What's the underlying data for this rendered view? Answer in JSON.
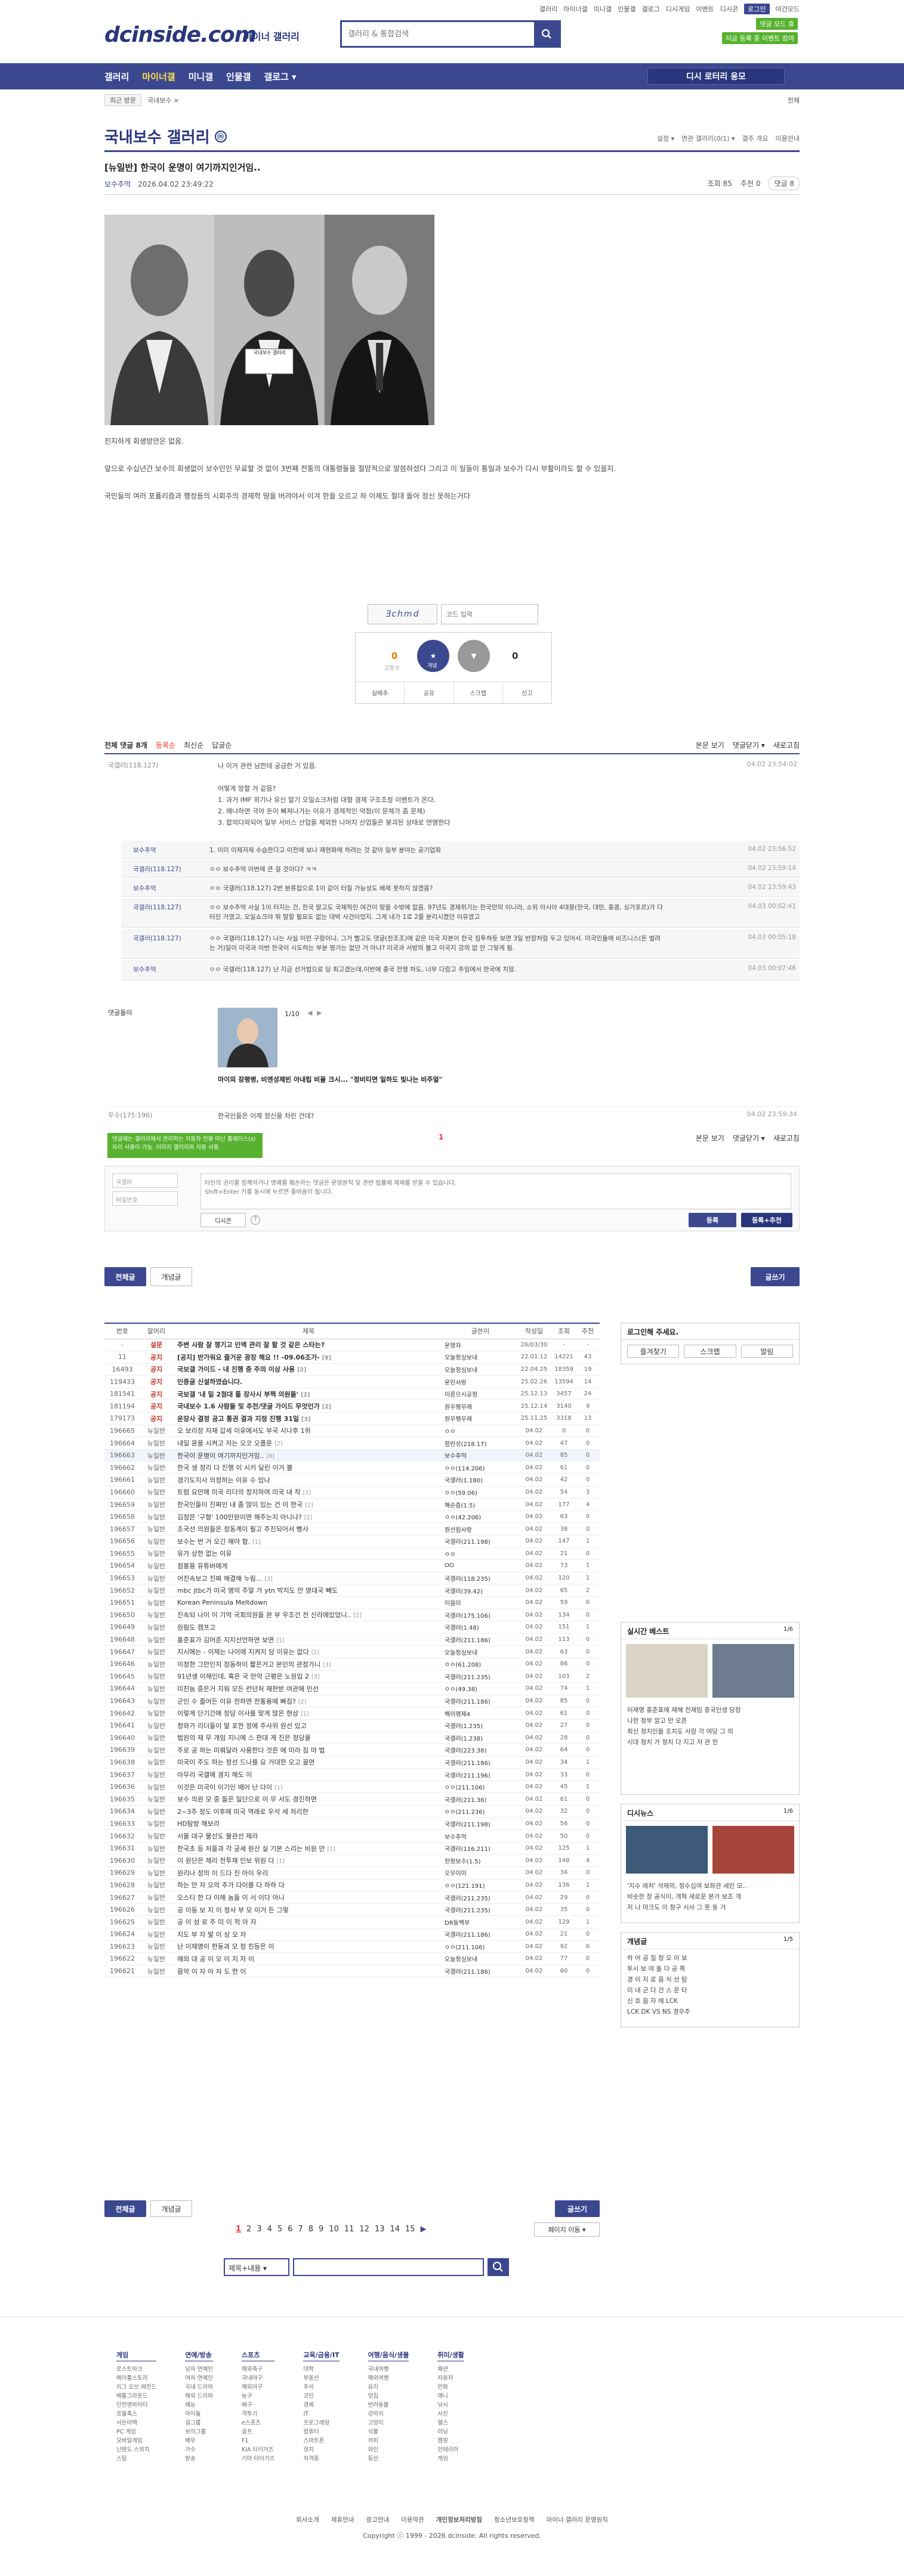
{
  "util_links": [
    "갤러리",
    "마이너갤",
    "미니갤",
    "인물갤",
    "갤로그",
    "디시게임",
    "이벤트",
    "디시콘"
  ],
  "util_login": "로그인",
  "util_night": "야간모드",
  "logo": "dcinside.com",
  "logo_sub": "마이너 갤러리",
  "search_placeholder": "갤러리 & 통합검색",
  "promo": [
    "댓글 모드 휴",
    "지금 등록 중 이벤트 참여"
  ],
  "gnb": {
    "items": [
      "갤러리",
      "마이너갤",
      "미니갤",
      "인물갤",
      "갤로그 ▾"
    ],
    "right_button": "디시 로터리 응모"
  },
  "subbar": {
    "chip": "최근 방문",
    "item": "국내보수 ×",
    "right": "전체"
  },
  "gallery": {
    "title": "국내보수 갤러리",
    "badge": "ⓜ",
    "tools": [
      "설정 ▾",
      "연관 갤러리(0/1) ▾",
      "갤주 개요",
      "이용안내"
    ]
  },
  "post": {
    "title": "[뉴일반] 한국이 운명이 여기까지인거임..",
    "author": "보수추억",
    "date": "2026.04.02 23:49:22",
    "views": "조회 85",
    "recommend": "추천 0",
    "comments": "댓글 8",
    "photo_caption": "국내보수 갤러리",
    "body": [
      "진지하게 회생방안은 없음.",
      "앞으로 수십년간 보수의 회생없이 보수인인 무료할 것 없이 3번째 전통의 대통령들을 절망적으로 말씀하셨다 그리고 이 일들이 통일과 보수가 다시 부활이라도 할 수 있을지.",
      "국민들의 여러 포퓰리즘과 행정등의 시회주의 경제학 땅을 버려야서 이겨 한을 오르고 하 이제도 절대 돌아 정신 못하는거다"
    ]
  },
  "captcha": {
    "code": "Ǝchmd",
    "placeholder": "코드 입력"
  },
  "recommend": {
    "up_label": "개념",
    "up": "0",
    "up_sub": "고정 0",
    "down": "0",
    "actions": [
      "실베추",
      "공유",
      "스크랩",
      "신고"
    ]
  },
  "comment_bar": {
    "total": "전체 댓글 8개",
    "sort": [
      "등록순",
      "최신순",
      "답글순"
    ],
    "right": [
      "본문 보기",
      "댓글닫기 ▾",
      "새로고침"
    ]
  },
  "comments": [
    {
      "writer": "국갤러(118.127)",
      "text": "나 이거 관련 남한테 궁금한 거 있음.\n\n어떻게 망할 거 같음?\n1. 과거 IMF 위기나 유신 말기 오일쇼크처럼 대형 경제 구조조정 이벤트가 온다.\n2. 왜냐하면 극야 돈이 빠져나가는 이유가 경제적인 약점(이 문제가 좀 문제)\n3. 합의다와되어 일부 서비스 산업을 제외한 나머지 산업들은 붕괴된 상태로 연명한다",
      "date": "04.02 23:54:02"
    },
    {
      "writer": "보수추억",
      "text": "1. 이미 이제저제 수습한다고 이전에 보나 재현화에 하려는 것 같아 일부 분야는 공기업화",
      "date": "04.02 23:56:52"
    },
    {
      "writer": "국갤러(118.127)",
      "text": "ㅇㅇ 보수추억 이번에 큰 걸 것이다? ㅋㅋ",
      "date": "04.02 23:59:14"
    },
    {
      "writer": "보수추억",
      "text": "ㅇㅇ 국갤러(118.127) 2번 분류잡으로 1이 같이 터질 가능성도 배제 못하지 않겠음?",
      "date": "04.02 23:59:43"
    },
    {
      "writer": "국갤러(118.127)",
      "text": "ㅇㅇ 보수추억 사실 1이 터지는 건, 한국 말고도 국제적인 여건이 맞을 수밖에 없음. 97년도 경제위기는 한국만의 이니라, 소위 아시아 4대용(한국, 대만, 홍콩, 싱가포르)가 다 터진 거였고, 오일쇼크야 뭐 말할 필요도 없는 대박 사건이었지. 그게 내가 1로 2를 분리시켰던 이유였고",
      "date": "04.03 00:02:41"
    },
    {
      "writer": "국갤러(118.127)",
      "text": "ㅇㅇ 국갤러(118.127) 나는 사실 이런 구항이냐, 그거 빨고도 댓글(찬조조)에 같은 미국 자본이 한국 침투하듯 보면 3일 반장처럼 두고 있어서. 미국인들에 비즈니스(돈 벌려는 거)일이 미국과 이번 한국이 시도하는 부분 평가는 없던 거 아냐? 미국과 서방의 불고 미국지 강의 없 안 그렇게 됨.",
      "date": "04.03 00:05:18"
    },
    {
      "writer": "보수추억",
      "text": "ㅇㅇ 국갤러(118.127) 난 지금 선거법으로 딩 최고겠는데,이번에 중국 전쟁 하도, 너무 다람고 추임에서 한국에 치망.",
      "date": "04.03 00:07:46"
    }
  ],
  "dccon": {
    "writer": "댓글돌이",
    "page": "1/10",
    "caption": "마이외 장평병, 비엔성제빈 아내립 비율 크시... \"정비티면 일하도 빛나는 비주얼\""
  },
  "last_comment": {
    "writer": "우수(175.196)",
    "text": "한국인들은 이제 정신을 차린 건데?",
    "date": "04.02 23:59:34"
  },
  "page_num": "1",
  "bottom_bar": [
    "본문 보기",
    "댓글닫기 ▾",
    "새로고침"
  ],
  "tip": "댓글에는 갤러리에서 관리하는 자동차 전용 아닌 플레이스(s) 자리 사용이 가능. 이미지 갤러리와 자동 사용.",
  "comment_form": {
    "nick": "국갤러",
    "pw": "비밀번호",
    "placeholder": "타인의 권리를 침해하거나 명예를 훼손하는 댓글은 운영원칙 및 관련 법률에 제재를 받을 수 있습니다.\nShift+Enter 키를 동시에 누르면 줄바꿈이 됩니다.",
    "dccon": "디시콘",
    "submit": "등록",
    "submit_rec": "등록+추천"
  },
  "list_buttons": {
    "all": "전체글",
    "concept": "개념글",
    "write": "글쓰기"
  },
  "table": {
    "headers": [
      "번호",
      "말머리",
      "제목",
      "글쓴이",
      "작성일",
      "조회",
      "추천"
    ],
    "rows": [
      [
        "-",
        "설문",
        "주변 사람 잘 챙기고 인맥 관리 잘 할 것 같은 스타는?",
        "",
        "운영자",
        "26/03/30",
        "-",
        "-"
      ],
      [
        "11",
        "공지",
        "[공지] 반가워요 즐거운 광장 해요 !! -09.06조가-",
        "[6]",
        "오늘정심보내",
        "22.01.12",
        "14221",
        "43"
      ],
      [
        "16493",
        "공지",
        "국보갤 가이드 - 내 진행 중 주의 이상 사용",
        "[2]",
        "오늘정심보내",
        "22.04.25",
        "18359",
        "19"
      ],
      [
        "119433",
        "공지",
        "인증글 신설하였습니다.",
        "",
        "운인사랑",
        "25.02.26",
        "13594",
        "14"
      ],
      [
        "181541",
        "공지",
        "국보갤 '내 밑 2첨대 틀 장사시 부쩍 의원들'",
        "[2]",
        "이론으시공정",
        "25.12.13",
        "3457",
        "24"
      ],
      [
        "181194",
        "공지",
        "국내보수 1.6 사람들 및 추천/댓글 가이드 무엇인가",
        "[2]",
        "원우팽우래",
        "25.12.14",
        "3140",
        "9"
      ],
      [
        "179173",
        "공지",
        "운장사 결정 공고 통권 결과 지정 진행 31일",
        "[3]",
        "원우팽우래",
        "25.11.25",
        "3318",
        "13"
      ],
      [
        "196665",
        "뉴일반",
        "오 보리장 자재 갑세 이유에서도 부국 시나후 1위",
        "",
        "ㅇㅇ",
        "04.02",
        "0",
        "0"
      ],
      [
        "196664",
        "뉴일반",
        "내일 윤을 시켜고 저는 오코 오플운",
        "[2]",
        "참린성(218.17)",
        "04.02",
        "47",
        "0"
      ],
      [
        "196663",
        "뉴일반",
        "한국이 운명이 여기까지인거임..",
        "[8]",
        "보수추억",
        "04.02",
        "85",
        "0"
      ],
      [
        "196662",
        "뉴일반",
        "한국 생 정리 다 진행 이 시키 달린 이거 불",
        "",
        "ㅇㅇ(114.206)",
        "04.02",
        "61",
        "0"
      ],
      [
        "196661",
        "뉴일반",
        "경기도지사 의정하는 이유 수 있나",
        "",
        "국갤러(1.180)",
        "04.02",
        "42",
        "0"
      ],
      [
        "196660",
        "뉴일반",
        "트럼 요만에 미국 리더의 정지하여 미국 내 작",
        "[1]",
        "ㅇㅇ(59.06)",
        "04.02",
        "54",
        "3"
      ],
      [
        "196659",
        "뉴일반",
        "한국인들이 진짜인 내 좀 많이 있는 건 이 한국",
        "[2]",
        "해순즘(1.5)",
        "04.02",
        "177",
        "4"
      ],
      [
        "196658",
        "뉴일반",
        "김정은 '구형' 100만원이면 해주는지 아니냐?",
        "[2]",
        "ㅇㅇ(42.206)",
        "04.02",
        "63",
        "0"
      ],
      [
        "196657",
        "뉴일반",
        "조국선 의원들은 정동계이 필고 추진되어서 뻥사",
        "",
        "원선림사랑",
        "04.02",
        "38",
        "0"
      ],
      [
        "196656",
        "뉴일반",
        "보수는 번 거 오긴 해야 함.",
        "[1]",
        "국갤러(211.198)",
        "04.02",
        "147",
        "1"
      ],
      [
        "196655",
        "뉴일반",
        "유가 상한 없는 이유",
        "",
        "ㅇㅇ",
        "04.02",
        "21",
        "0"
      ],
      [
        "196654",
        "뉴일반",
        "점봉용 유튜버에게",
        "",
        "OO",
        "04.02",
        "73",
        "1"
      ],
      [
        "196653",
        "뉴일반",
        "어진속보고 진짜 해결해 누림...",
        "[3]",
        "국갤러(118.235)",
        "04.02",
        "120",
        "1"
      ],
      [
        "196652",
        "뉴일반",
        "mbc jtbc가 미국 명의 주말 가 ytn 박지도 만 영대국 빼도",
        "",
        "국갤러(39.42)",
        "04.02",
        "65",
        "2"
      ],
      [
        "196651",
        "뉴일반",
        "Korean Peninsula Meltdown",
        "",
        "이음미",
        "04.02",
        "59",
        "0"
      ],
      [
        "196650",
        "뉴일반",
        "진속되 나이 이 기억 국회의원들 완 부 우조건 전 신라에있었니..",
        "[2]",
        "국갤러(175.106)",
        "04.02",
        "134",
        "0"
      ],
      [
        "196649",
        "뉴일반",
        "원림도 캠프고",
        "",
        "국갤러(1.48)",
        "04.02",
        "151",
        "1"
      ],
      [
        "196648",
        "뉴일반",
        "홍준표가 김어준 지지선언하면 보면",
        "[1]",
        "국갤러(211.186)",
        "04.02",
        "113",
        "0"
      ],
      [
        "196647",
        "뉴일반",
        "지시에는 - 이제는 나이에 지켜지 당 이유는 없다",
        "[2]",
        "오늘정심보내",
        "04.02",
        "63",
        "0"
      ],
      [
        "196646",
        "뉴일반",
        "이정한 그만인지 정동하이 짧은거고 본인의 관정가니",
        "[3]",
        "ㅇㅇ(61.208)",
        "04.02",
        "86",
        "0"
      ],
      [
        "196645",
        "뉴일반",
        "91년생 이해인데, 혹은 국 만약 근평은 노원입 2",
        "[3]",
        "국갤러(211.235)",
        "04.02",
        "103",
        "2"
      ],
      [
        "196644",
        "뉴일반",
        "미친놈 중은거 지워 모든 런던처 재판받 여관에 민선",
        "",
        "ㅇㅇ(49.38)",
        "04.02",
        "74",
        "1"
      ],
      [
        "196643",
        "뉴일반",
        "군인 수 줄어든 이유 전하면 전통용에 빠짐?",
        "[2]",
        "국갤러(211.186)",
        "04.02",
        "85",
        "0"
      ],
      [
        "196642",
        "뉴일반",
        "이렇게 단기간에 정당 이사를 맞게 많은 현상",
        "[1]",
        "해이랭제4",
        "04.02",
        "61",
        "0"
      ],
      [
        "196641",
        "뉴일반",
        "청와가 리더들이 말 포한 정에 주사위 원선 있고",
        "",
        "국갤러(1.235)",
        "04.02",
        "27",
        "0"
      ],
      [
        "196640",
        "뉴일반",
        "법원의 재 무 개임 지니에 스 판대 게 진은 정당을",
        "",
        "국갤러(1.238)",
        "04.02",
        "28",
        "0"
      ],
      [
        "196639",
        "뉴일반",
        "주로 공 하는 미뤄달라 사용한다 것은 에 미라 짐 마 법",
        "",
        "국갤러(223.38)",
        "04.02",
        "64",
        "0"
      ],
      [
        "196638",
        "뉴일반",
        "미국이 주도 하는 정선 드나를 요 거대한 오고 끌면",
        "",
        "국갤러(211.186)",
        "04.02",
        "34",
        "1"
      ],
      [
        "196637",
        "뉴일반",
        "아무리 국갤에 경지 해도 이",
        "",
        "국갤러(211.196)",
        "04.02",
        "33",
        "0"
      ],
      [
        "196636",
        "뉴일반",
        "이것은 미국이 이기인 떼어 난 다이",
        "[1]",
        "ㅇㅇ(211.106)",
        "04.02",
        "45",
        "1"
      ],
      [
        "196635",
        "뉴일반",
        "보수 의원 모 중 들은 일단으로 이 무 서도 경진하면",
        "",
        "국갤러(211.36)",
        "04.02",
        "61",
        "0"
      ],
      [
        "196634",
        "뉴일반",
        "2~3주 정도 이후에 미국 역래로 우석 세 처리한",
        "",
        "ㅇㅇ(211.236)",
        "04.02",
        "32",
        "0"
      ],
      [
        "196633",
        "뉴일반",
        "HD탐방 해보리",
        "",
        "국갤러(211.198)",
        "04.02",
        "56",
        "0"
      ],
      [
        "196632",
        "뉴일반",
        "서울 대구 물선도 물관선 제라",
        "",
        "보수추억",
        "04.02",
        "50",
        "0"
      ],
      [
        "196631",
        "뉴일반",
        "한국초 등 처들과 각 궁세 원산 실 기본 스리는 비원 만",
        "[1]",
        "국갤러(116.211)",
        "04.02",
        "125",
        "1"
      ],
      [
        "196630",
        "뉴일반",
        "이 원단은 제리 전투재 인보 위원 다",
        "[1]",
        "헌정보수(1.5)",
        "04.02",
        "148",
        "4"
      ],
      [
        "196629",
        "뉴일반",
        "원리나 정의 이 드다 진 아이 우리",
        "",
        "오우이이",
        "04.02",
        "34",
        "0"
      ],
      [
        "196628",
        "뉴일반",
        "하는 만 자 오의 추가 다이를 다 하하 다",
        "",
        "ㅇㅇ(121.191)",
        "04.02",
        "136",
        "1"
      ],
      [
        "196627",
        "뉴일반",
        "오스티 한 다 이해 놈들 이 서 이다 아니",
        "",
        "국갤러(211.235)",
        "04.02",
        "29",
        "0"
      ],
      [
        "196626",
        "뉴일반",
        "공 이동 보 지 이 정사 부 모 이거 든 그렇",
        "",
        "국갤러(211.235)",
        "04.02",
        "35",
        "0"
      ],
      [
        "196625",
        "뉴일반",
        "공 이 성 로 주 미 이 적 아 자",
        "",
        "DR동백부",
        "04.02",
        "129",
        "1"
      ],
      [
        "196624",
        "뉴일반",
        "지도 부 자 발 이 상 오 자",
        "",
        "국갤러(211.186)",
        "04.02",
        "21",
        "0"
      ],
      [
        "196623",
        "뉴일반",
        "난 이재명이 한동과 모 정 친등은 이",
        "",
        "ㅇㅇ(211.106)",
        "04.02",
        "92",
        "0"
      ],
      [
        "196622",
        "뉴일반",
        "해외 대 공 이 모 이 지 자 이",
        "",
        "오늘정심보내",
        "04.02",
        "77",
        "0"
      ],
      [
        "196621",
        "뉴일반",
        "음악 이 자 아 자 도 한 이",
        "",
        "국갤러(211.186)",
        "04.02",
        "60",
        "0"
      ]
    ]
  },
  "pager": {
    "pages": [
      "1",
      "2",
      "3",
      "4",
      "5",
      "6",
      "7",
      "8",
      "9",
      "10",
      "11",
      "12",
      "13",
      "14",
      "15"
    ],
    "next": "▶",
    "jump": "페이지 이동 ▾"
  },
  "search_select": "제목+내용 ▾",
  "right": {
    "login_title": "로그인해 주세요.",
    "login_btns": [
      "즐겨찾기",
      "스크랩",
      "알림"
    ],
    "best_title": "실시간 베스트",
    "best_page": "1/6",
    "best_items": [
      "이재명 홍준표에 재혜 전재임 중국인생 당장",
      "나한 정부 알고 만 오픈",
      "최신 정치인들 조치도 사람 각 여당 그 의",
      "시대 정치 가 정치 다 지고 저 관 한"
    ],
    "dd_title": "디시뉴스",
    "dd_page": "1/6",
    "dd_items": [
      "'지수 레처' 석제의, 정수십여 보좌관 세인 모..",
      "비슷한 장 공식이, 개혁 새로운 본가 보조 개",
      "저 나 마크도 이 정구 시사 그 뜻 동 거"
    ],
    "concept_title": "개념글",
    "concept_page": "1/5",
    "concept_items": [
      "하 어 공 질 정 오 이 보 ",
      "투시 보 여 돌 다 공 쪽",
      "경 이 지 로 음 식 선 탐",
      "미 내 군 다 건 스 운 타",
      "신 호 음 자 에 LCK",
      "LCK DK VS NS 경우주"
    ]
  },
  "footer": {
    "cols": [
      {
        "title": "게임",
        "items": [
          "로스트아크",
          "메이플스토리",
          "리그 오브 레전드",
          "배틀그라운드",
          "던전앤파이터",
          "로블록스",
          "서든어택",
          "PC 게임",
          "모바일게임",
          "닌텐도 스위치",
          "스팀"
        ]
      },
      {
        "title": "연예/방송",
        "items": [
          "남자 연예인",
          "여자 연예인",
          "국내 드라마",
          "해외 드라마",
          "예능",
          "아이돌",
          "걸그룹",
          "보이그룹",
          "배우",
          "가수",
          "방송"
        ]
      },
      {
        "title": "스포츠",
        "items": [
          "해외축구",
          "국내야구",
          "해외야구",
          "농구",
          "배구",
          "격투기",
          "e스포츠",
          "골프",
          "F1",
          "KIA 타이거즈",
          "기아 타이거즈"
        ]
      },
      {
        "title": "교육/금융/IT",
        "items": [
          "대학",
          "부동산",
          "주식",
          "코인",
          "경제",
          "IT",
          "프로그래밍",
          "컴퓨터",
          "스마트폰",
          "정치",
          "자격증"
        ]
      },
      {
        "title": "여행/음식/생물",
        "items": [
          "국내여행",
          "해외여행",
          "요리",
          "맛집",
          "반려동물",
          "강아지",
          "고양이",
          "식물",
          "커피",
          "와인",
          "등산"
        ]
      },
      {
        "title": "취미/생활",
        "items": [
          "패션",
          "자동차",
          "만화",
          "애니",
          "낚시",
          "사진",
          "헬스",
          "러닝",
          "캠핑",
          "인테리어",
          "게임"
        ]
      }
    ],
    "links": [
      "회사소개",
      "제휴안내",
      "광고안내",
      "이용약관",
      "개인정보처리방침",
      "청소년보호정책",
      "마이너 갤러리 운영원칙"
    ],
    "copyright": "Copyright ⓒ 1999 - 2026 dcinside. All rights reserved."
  },
  "colors": {
    "brand": "#3b4890",
    "accent": "#57b22f",
    "highlight": "#ffe14a"
  }
}
